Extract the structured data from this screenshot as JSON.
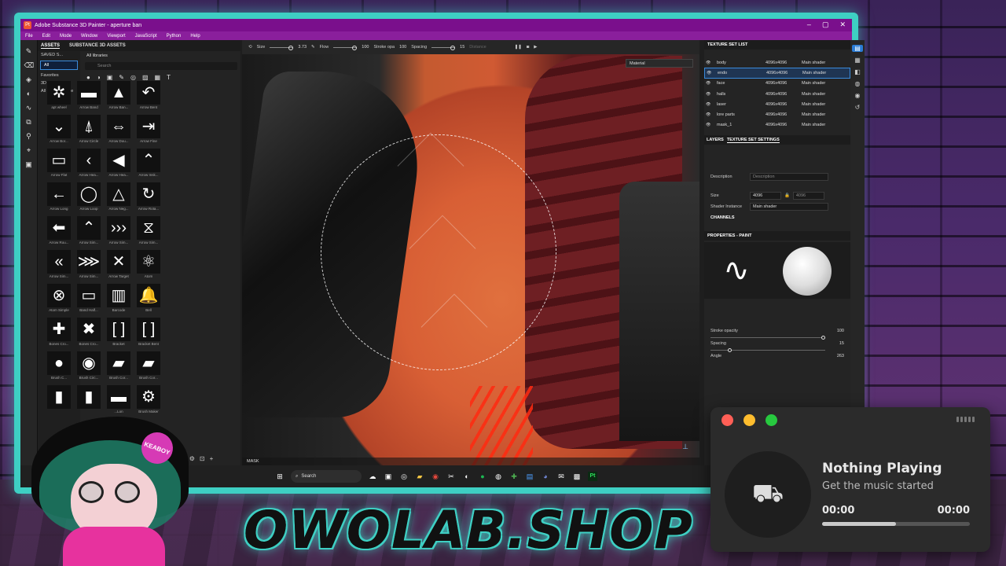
{
  "window": {
    "title": "Adobe Substance 3D Painter - aperture ban",
    "app_logo": "Pt",
    "controls": [
      "–",
      "▢",
      "✕"
    ]
  },
  "menu": [
    "File",
    "Edit",
    "Mode",
    "Window",
    "Viewport",
    "JavaScript",
    "Python",
    "Help"
  ],
  "assets_panel": {
    "tabs": [
      "ASSETS",
      "SUBSTANCE 3D ASSETS"
    ],
    "saved_label": "SAVED S...",
    "side": [
      "All",
      "Favorites",
      "3D Assets",
      "All - starter_asse"
    ],
    "library": "All libraries",
    "search_placeholder": "Search",
    "items": [
      {
        "glyph": "✲",
        "label": "apt wheel"
      },
      {
        "glyph": "▬",
        "label": "Arrow Band"
      },
      {
        "glyph": "▲",
        "label": "Arrow Ban..."
      },
      {
        "glyph": "↶",
        "label": "Arrow Bent"
      },
      {
        "glyph": "⌄",
        "label": "Arrow Bor..."
      },
      {
        "glyph": "⍋",
        "label": "Arrow Circle"
      },
      {
        "glyph": "⇔",
        "label": "Arrow Dou..."
      },
      {
        "glyph": "⇥",
        "label": "Arrow Fine"
      },
      {
        "glyph": "▭",
        "label": "Arrow Flat"
      },
      {
        "glyph": "‹",
        "label": "Arrow Hea..."
      },
      {
        "glyph": "◀",
        "label": "Arrow Hea..."
      },
      {
        "glyph": "⌃",
        "label": "Arrow Insk..."
      },
      {
        "glyph": "←",
        "label": "Arrow Long"
      },
      {
        "glyph": "◯",
        "label": "Arrow Loop"
      },
      {
        "glyph": "△",
        "label": "Arrow Neg..."
      },
      {
        "glyph": "↻",
        "label": "Arrow Rota..."
      },
      {
        "glyph": "⬅",
        "label": "Arrow Rou..."
      },
      {
        "glyph": "⌃",
        "label": "Arrow Sim..."
      },
      {
        "glyph": "›››",
        "label": "Arrow Sim..."
      },
      {
        "glyph": "⧖",
        "label": "Arrow Sim..."
      },
      {
        "glyph": "«",
        "label": "Arrow Sim..."
      },
      {
        "glyph": "⋙",
        "label": "Arrow Sim..."
      },
      {
        "glyph": "✕",
        "label": "Arrow Target"
      },
      {
        "glyph": "⚛",
        "label": "Atom"
      },
      {
        "glyph": "⊗",
        "label": "Atom Simple"
      },
      {
        "glyph": "▭",
        "label": "Band Half..."
      },
      {
        "glyph": "▥",
        "label": "Barcode"
      },
      {
        "glyph": "🔔",
        "label": "Bell"
      },
      {
        "glyph": "✚",
        "label": "Bones Cro..."
      },
      {
        "glyph": "✖",
        "label": "Bones Cro..."
      },
      {
        "glyph": "[ ]",
        "label": "Bracket"
      },
      {
        "glyph": "[ ]",
        "label": "Bracket Bent"
      },
      {
        "glyph": "●",
        "label": "Brush C..."
      },
      {
        "glyph": "◉",
        "label": "Brush Circ..."
      },
      {
        "glyph": "▰",
        "label": "Brush Cor..."
      },
      {
        "glyph": "▰",
        "label": "Brush Cor..."
      },
      {
        "glyph": "▮",
        "label": ""
      },
      {
        "glyph": "▮",
        "label": ""
      },
      {
        "glyph": "▬",
        "label": "...Lon"
      },
      {
        "glyph": "⚙",
        "label": "Brush Maker"
      }
    ]
  },
  "viewport": {
    "size_label": "Size",
    "size_val": "3.73",
    "flow_label": "Flow",
    "flow_val": "100",
    "stroke_label": "Stroke opa",
    "stroke_val": "100",
    "spacing_label": "Spacing",
    "spacing_val": "15",
    "distance_label": "Distance",
    "material_select": "Material",
    "bottom_label": "MASK"
  },
  "texture_set_list": {
    "title": "TEXTURE SET LIST",
    "rows": [
      {
        "name": "body",
        "res": "4096x4096",
        "shader": "Main shader"
      },
      {
        "name": "endo",
        "res": "4096x4096",
        "shader": "Main shader"
      },
      {
        "name": "face",
        "res": "4096x4096",
        "shader": "Main shader"
      },
      {
        "name": "halls",
        "res": "4096x4096",
        "shader": "Main shader"
      },
      {
        "name": "laser",
        "res": "4096x4096",
        "shader": "Main shader"
      },
      {
        "name": "lore parts",
        "res": "4096x4096",
        "shader": "Main shader"
      },
      {
        "name": "mask_1",
        "res": "4096x4096",
        "shader": "Main shader"
      }
    ]
  },
  "settings": {
    "tabs": [
      "LAYERS",
      "TEXTURE SET SETTINGS"
    ],
    "description_label": "Description",
    "description_placeholder": "Description",
    "size_label": "Size",
    "size_val": "4096",
    "size_val2": "4096",
    "shader_label": "Shader Instance",
    "shader_val": "Main shader",
    "channels": "CHANNELS"
  },
  "properties": {
    "title": "PROPERTIES - PAINT",
    "stroke_opacity_label": "Stroke opacity",
    "stroke_opacity_val": "100",
    "spacing_label": "Spacing",
    "spacing_val": "15",
    "angle_label": "Angle",
    "angle_val": "263",
    "stroke_opacity": 1.0,
    "spacing": 0.15
  },
  "taskbar": {
    "search": "Search",
    "icons": [
      "windows-icon",
      "search-icon",
      "widgets-icon",
      "taskview-icon",
      "steam-icon",
      "folder-icon",
      "chrome-icon",
      "capcut-icon",
      "steam2-icon",
      "spotify-icon",
      "obs-icon",
      "gamepass-icon",
      "notepad-icon",
      "discord-icon",
      "mail-icon",
      "terminal-icon",
      "painter-icon"
    ]
  },
  "music": {
    "title": "Nothing Playing",
    "subtitle": "Get the music started",
    "time_current": "00:00",
    "time_total": "00:00",
    "progress": 0.5,
    "dots": [
      "#ff5f56",
      "#ffbd2e",
      "#27c93f"
    ]
  },
  "overlay": {
    "brand": "OWOLAB.SHOP",
    "badge": "KEABOY"
  },
  "colors": {
    "frame": "#3ecfc3",
    "titlebar": "#7a0f8c",
    "accent": "#3a8bdc"
  }
}
